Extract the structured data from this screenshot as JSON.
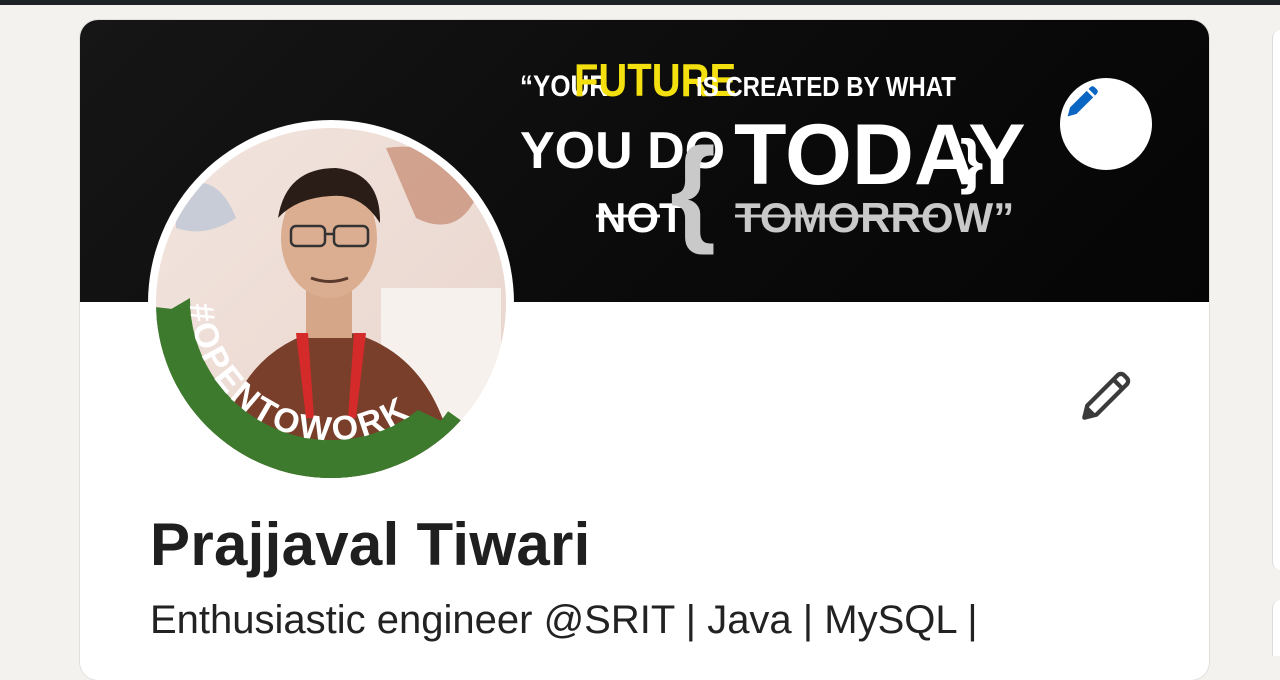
{
  "banner": {
    "quote_line1_pre": "“YOUR",
    "quote_line1_future": "FUTURE",
    "quote_line1_post": "IS CREATED BY WHAT",
    "quote_you_do": "YOU DO",
    "quote_not": "NOT",
    "quote_today": "TODAY",
    "quote_tomorrow": "TOMORROW”",
    "accent_color": "#f4e00f"
  },
  "avatar": {
    "badge_text": "#OPENTOWORK",
    "badge_color": "#3d7a2d"
  },
  "profile": {
    "name": "Prajjaval Tiwari",
    "headline": "Enthusiastic engineer @SRIT | Java | MySQL |"
  },
  "icons": {
    "banner_edit": "pencil-icon",
    "profile_edit": "pencil-icon"
  },
  "colors": {
    "edit_icon_blue": "#0a66c2",
    "text_dark": "#1f1f1f"
  }
}
